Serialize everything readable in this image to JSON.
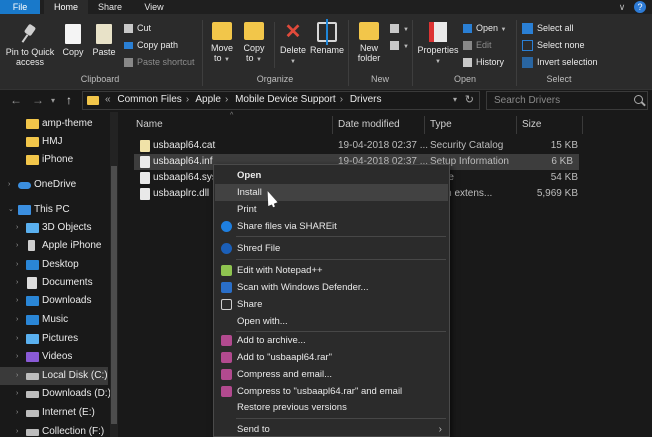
{
  "tabs": {
    "file": "File",
    "home": "Home",
    "share": "Share",
    "view": "View"
  },
  "ribbon_toggle": "∨",
  "help": "?",
  "ribbon": {
    "clipboard": {
      "group_label": "Clipboard",
      "pin_label": "Pin to Quick access",
      "copy_label": "Copy",
      "paste_label": "Paste",
      "cut_label": "Cut",
      "copy_path_label": "Copy path",
      "paste_shortcut_label": "Paste shortcut"
    },
    "organize": {
      "group_label": "Organize",
      "move_to_label": "Move to",
      "copy_to_label": "Copy to",
      "delete_label": "Delete",
      "rename_label": "Rename"
    },
    "new": {
      "group_label": "New",
      "new_folder_label": "New folder"
    },
    "open": {
      "group_label": "Open",
      "properties_label": "Properties",
      "open_label": "Open",
      "edit_label": "Edit",
      "history_label": "History"
    },
    "select": {
      "group_label": "Select",
      "select_all_label": "Select all",
      "select_none_label": "Select none",
      "invert_label": "Invert selection"
    }
  },
  "address": {
    "overflow": "«",
    "crumbs": [
      "Common Files",
      "Apple",
      "Mobile Device Support",
      "Drivers"
    ],
    "search_placeholder": "Search Drivers"
  },
  "nav_pane": {
    "items": [
      {
        "label": "amp-theme",
        "icon": "folder-icon"
      },
      {
        "label": "HMJ",
        "icon": "folder-icon"
      },
      {
        "label": "iPhone",
        "icon": "folder-icon"
      },
      {
        "label": "OneDrive",
        "icon": "cloud-icon"
      },
      {
        "label": "This PC",
        "icon": "computer-icon"
      },
      {
        "label": "3D Objects",
        "icon": "cube-icon"
      },
      {
        "label": "Apple iPhone",
        "icon": "phone-icon"
      },
      {
        "label": "Desktop",
        "icon": "desktop-icon"
      },
      {
        "label": "Documents",
        "icon": "documents-icon"
      },
      {
        "label": "Downloads",
        "icon": "download-icon"
      },
      {
        "label": "Music",
        "icon": "music-icon"
      },
      {
        "label": "Pictures",
        "icon": "pictures-icon"
      },
      {
        "label": "Videos",
        "icon": "videos-icon"
      },
      {
        "label": "Local Disk (C:)",
        "icon": "drive-icon"
      },
      {
        "label": "Downloads (D:)",
        "icon": "drive-icon"
      },
      {
        "label": "Internet (E:)",
        "icon": "drive-icon"
      },
      {
        "label": "Collection (F:)",
        "icon": "drive-icon"
      }
    ]
  },
  "file_list": {
    "columns": {
      "name": "Name",
      "date": "Date modified",
      "type": "Type",
      "size": "Size"
    },
    "files": [
      {
        "name": "usbaapl64.cat",
        "date": "19-04-2018 02:37 ...",
        "type": "Security Catalog",
        "size": "15 KB"
      },
      {
        "name": "usbaapl64.inf",
        "date": "19-04-2018 02:37 ...",
        "type": "Setup Information",
        "size": "6 KB"
      },
      {
        "name": "usbaapl64.sys",
        "date": "",
        "type": "m file",
        "size": "54 KB"
      },
      {
        "name": "usbaaplrc.dll",
        "date": "",
        "type": "ation extens...",
        "size": "5,969 KB"
      }
    ]
  },
  "context_menu": {
    "items": [
      {
        "label": "Open",
        "icon": ""
      },
      {
        "label": "Install",
        "icon": ""
      },
      {
        "label": "Print",
        "icon": ""
      },
      {
        "label": "Share files via SHAREit",
        "icon": "shareit-icon"
      },
      {
        "label": "Shred File",
        "icon": "shred-icon"
      },
      {
        "label": "Edit with Notepad++",
        "icon": "notepadpp-icon"
      },
      {
        "label": "Scan with Windows Defender...",
        "icon": "defender-icon"
      },
      {
        "label": "Share",
        "icon": "share-icon"
      },
      {
        "label": "Open with...",
        "icon": ""
      },
      {
        "label": "Add to archive...",
        "icon": "winrar-icon"
      },
      {
        "label": "Add to \"usbaapl64.rar\"",
        "icon": "winrar-icon"
      },
      {
        "label": "Compress and email...",
        "icon": "winrar-icon"
      },
      {
        "label": "Compress to \"usbaapl64.rar\" and email",
        "icon": "winrar-icon"
      },
      {
        "label": "Restore previous versions",
        "icon": ""
      },
      {
        "label": "Send to",
        "icon": ""
      }
    ],
    "submenu_arrow": "›"
  }
}
